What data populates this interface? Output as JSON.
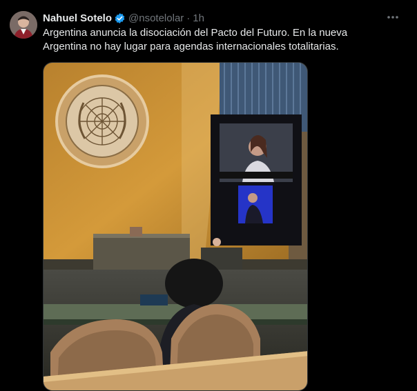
{
  "tweet": {
    "display_name": "Nahuel Sotelo",
    "handle": "@nsotelolar",
    "separator": "·",
    "time": "1h",
    "text": "Argentina anuncia la disociación del Pacto del Futuro.  En la nueva\nArgentina no hay lugar para agendas internacionales totalitarias.",
    "verified_icon": "verified-badge-icon",
    "more_icon": "more-options-icon"
  },
  "colors": {
    "verified_blue": "#1d9bf0",
    "secondary_text": "#71767b",
    "primary_text": "#e7e9ea",
    "background": "#000000"
  }
}
